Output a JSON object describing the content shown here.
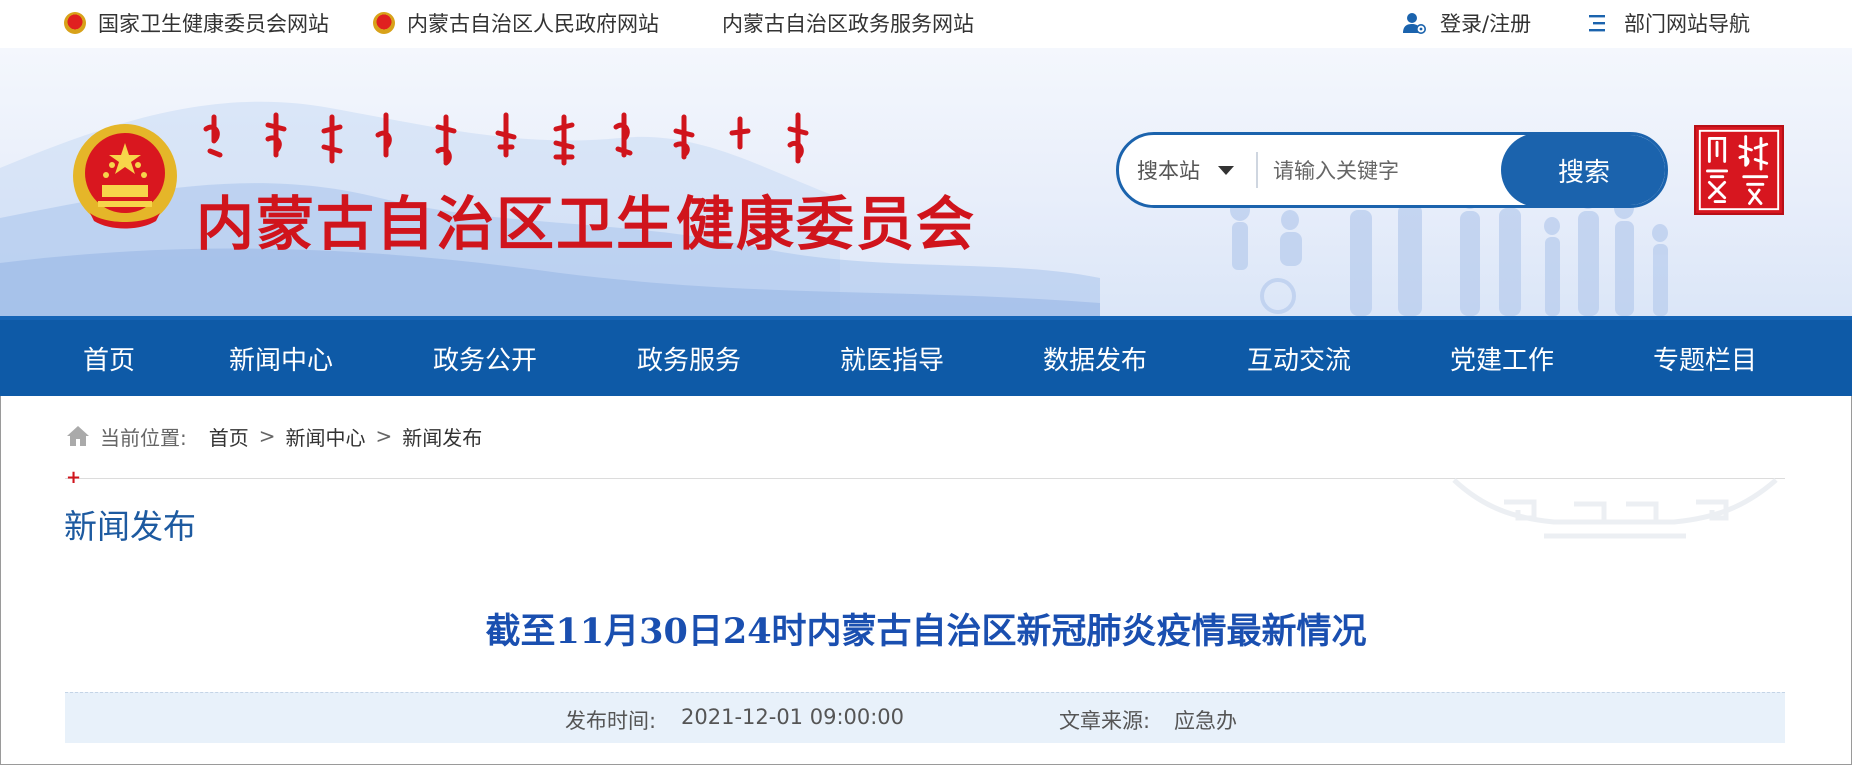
{
  "topbar": {
    "links": [
      {
        "label": "国家卫生健康委员会网站",
        "icon": "national-emblem-icon"
      },
      {
        "label": "内蒙古自治区人民政府网站",
        "icon": "national-emblem-icon"
      },
      {
        "label": "内蒙古自治区政务服务网站"
      }
    ],
    "login": {
      "label": "登录/注册",
      "icon": "user-icon"
    },
    "nav_guide": {
      "label": "部门网站导航",
      "icon": "list-menu-icon"
    }
  },
  "header": {
    "title": "内蒙古自治区卫生健康委员会",
    "emblem": "national-emblem",
    "seal": "inner-mongolia-seal"
  },
  "search": {
    "scope": "搜本站",
    "placeholder": "请输入关键字",
    "value": "",
    "button": "搜索"
  },
  "nav": {
    "items": [
      "首页",
      "新闻中心",
      "政务公开",
      "政务服务",
      "就医指导",
      "数据发布",
      "互动交流",
      "党建工作",
      "专题栏目"
    ]
  },
  "breadcrumb": {
    "prefix": "当前位置:",
    "items": [
      "首页",
      "新闻中心",
      "新闻发布"
    ],
    "separator": ">"
  },
  "section": {
    "title": "新闻发布"
  },
  "article": {
    "title": "截至11月30日24时内蒙古自治区新冠肺炎疫情最新情况",
    "publish_label": "发布时间:",
    "publish_time": "2021-12-01 09:00:00",
    "source_label": "文章来源:",
    "source": "应急办"
  },
  "colors": {
    "brand_red": "#d0141c",
    "nav_blue": "#0e5aa7",
    "title_blue": "#1a4fb0",
    "meta_bg": "#e8f1fa"
  }
}
